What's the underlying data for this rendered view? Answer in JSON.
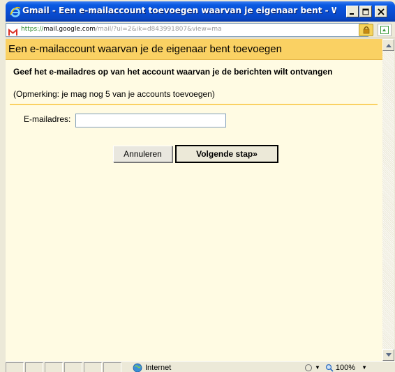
{
  "window": {
    "title": "Gmail - Een e-mailaccount toevoegen waarvan je eigenaar bent - Windows Internet...",
    "accent_color": "#0A5AE2"
  },
  "addressbar": {
    "url_scheme": "https://",
    "url_host": "mail.google.com",
    "url_path": "/mail/?ui=2&ik=d843991807&view=ma",
    "favicon": "gmail-icon",
    "lock_icon": "padlock-icon",
    "compat_icon": "compatibility-view-icon"
  },
  "dialog": {
    "title": "Een e-mailaccount waarvan je de eigenaar bent toevoegen",
    "instruction": "Geef het e-mailadres op van het account waarvan je de berichten wilt ontvangen",
    "note": "(Opmerking: je mag nog 5 van je accounts toevoegen)",
    "email_label": "E-mailadres:",
    "email_value": "",
    "cancel_label": "Annuleren",
    "next_label": "Volgende stap»",
    "header_color": "#FAD163",
    "background_color": "#FFFBE3"
  },
  "statusbar": {
    "zone": "Internet",
    "zoom": "100%"
  }
}
